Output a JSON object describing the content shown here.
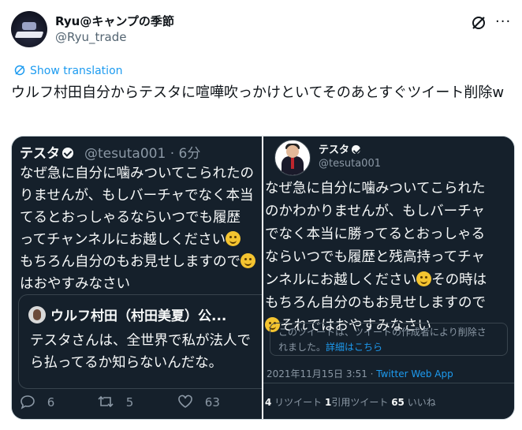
{
  "header": {
    "display_name": "Ryu@キャンプの季節",
    "handle": "@Ryu_trade",
    "grok_icon": "grok-icon",
    "more_icon": "more-horizontal-icon"
  },
  "translate_label": "Show translation",
  "tweet_text": "ウルフ村田自分からテスタに喧嘩吹っかけといてそのあとすぐツイート削除w",
  "left_screenshot": {
    "name": "テスタ",
    "handle_time": "@tesuta001 · 6分",
    "line1": "なぜ急に自分に噛みついてこられたの",
    "line2": "りませんが、もしバーチャでなく本当",
    "line3": "てるとおっしゃるならいつでも履歴",
    "line4": "ってチャンネルにお越しください",
    "line5": "もちろん自分のもお見せしますので",
    "line6": "はおやすみなさい",
    "quote_name": "ウルフ村田（村田美夏）公...",
    "quote_line1": "テスタさんは、全世界で私が法人で",
    "quote_line2": "ら払ってるか知らないんだな。",
    "replies": "6",
    "retweets": "5",
    "likes": "63"
  },
  "right_screenshot": {
    "name": "テスタ",
    "handle": "@tesuta001",
    "line1": "なぜ急に自分に噛みついてこられた",
    "line2": "のかわかりませんが、もしバーチャ",
    "line3": "でなく本当に勝ってるとおっしゃる",
    "line4": "ならいつでも履歴と残高持ってチャ",
    "line5a": "ンネルにお越しください",
    "line5b": "その時は",
    "line6": "もちろん自分のもお見せしますので",
    "line7": "それではおやすみなさい",
    "deleted_text1": "このツイートは、ツイートの作成者により削除さ",
    "deleted_text2": "れました。",
    "deleted_link": "詳細はこちら",
    "timestamp": "2021年11月15日 3:51 · ",
    "app": "Twitter Web App",
    "retweets_count": "4",
    "retweets_label": " リツイート ",
    "quotes_count": "1",
    "quotes_label": "引用ツイート ",
    "likes_count": "65",
    "likes_label": " いいね"
  }
}
